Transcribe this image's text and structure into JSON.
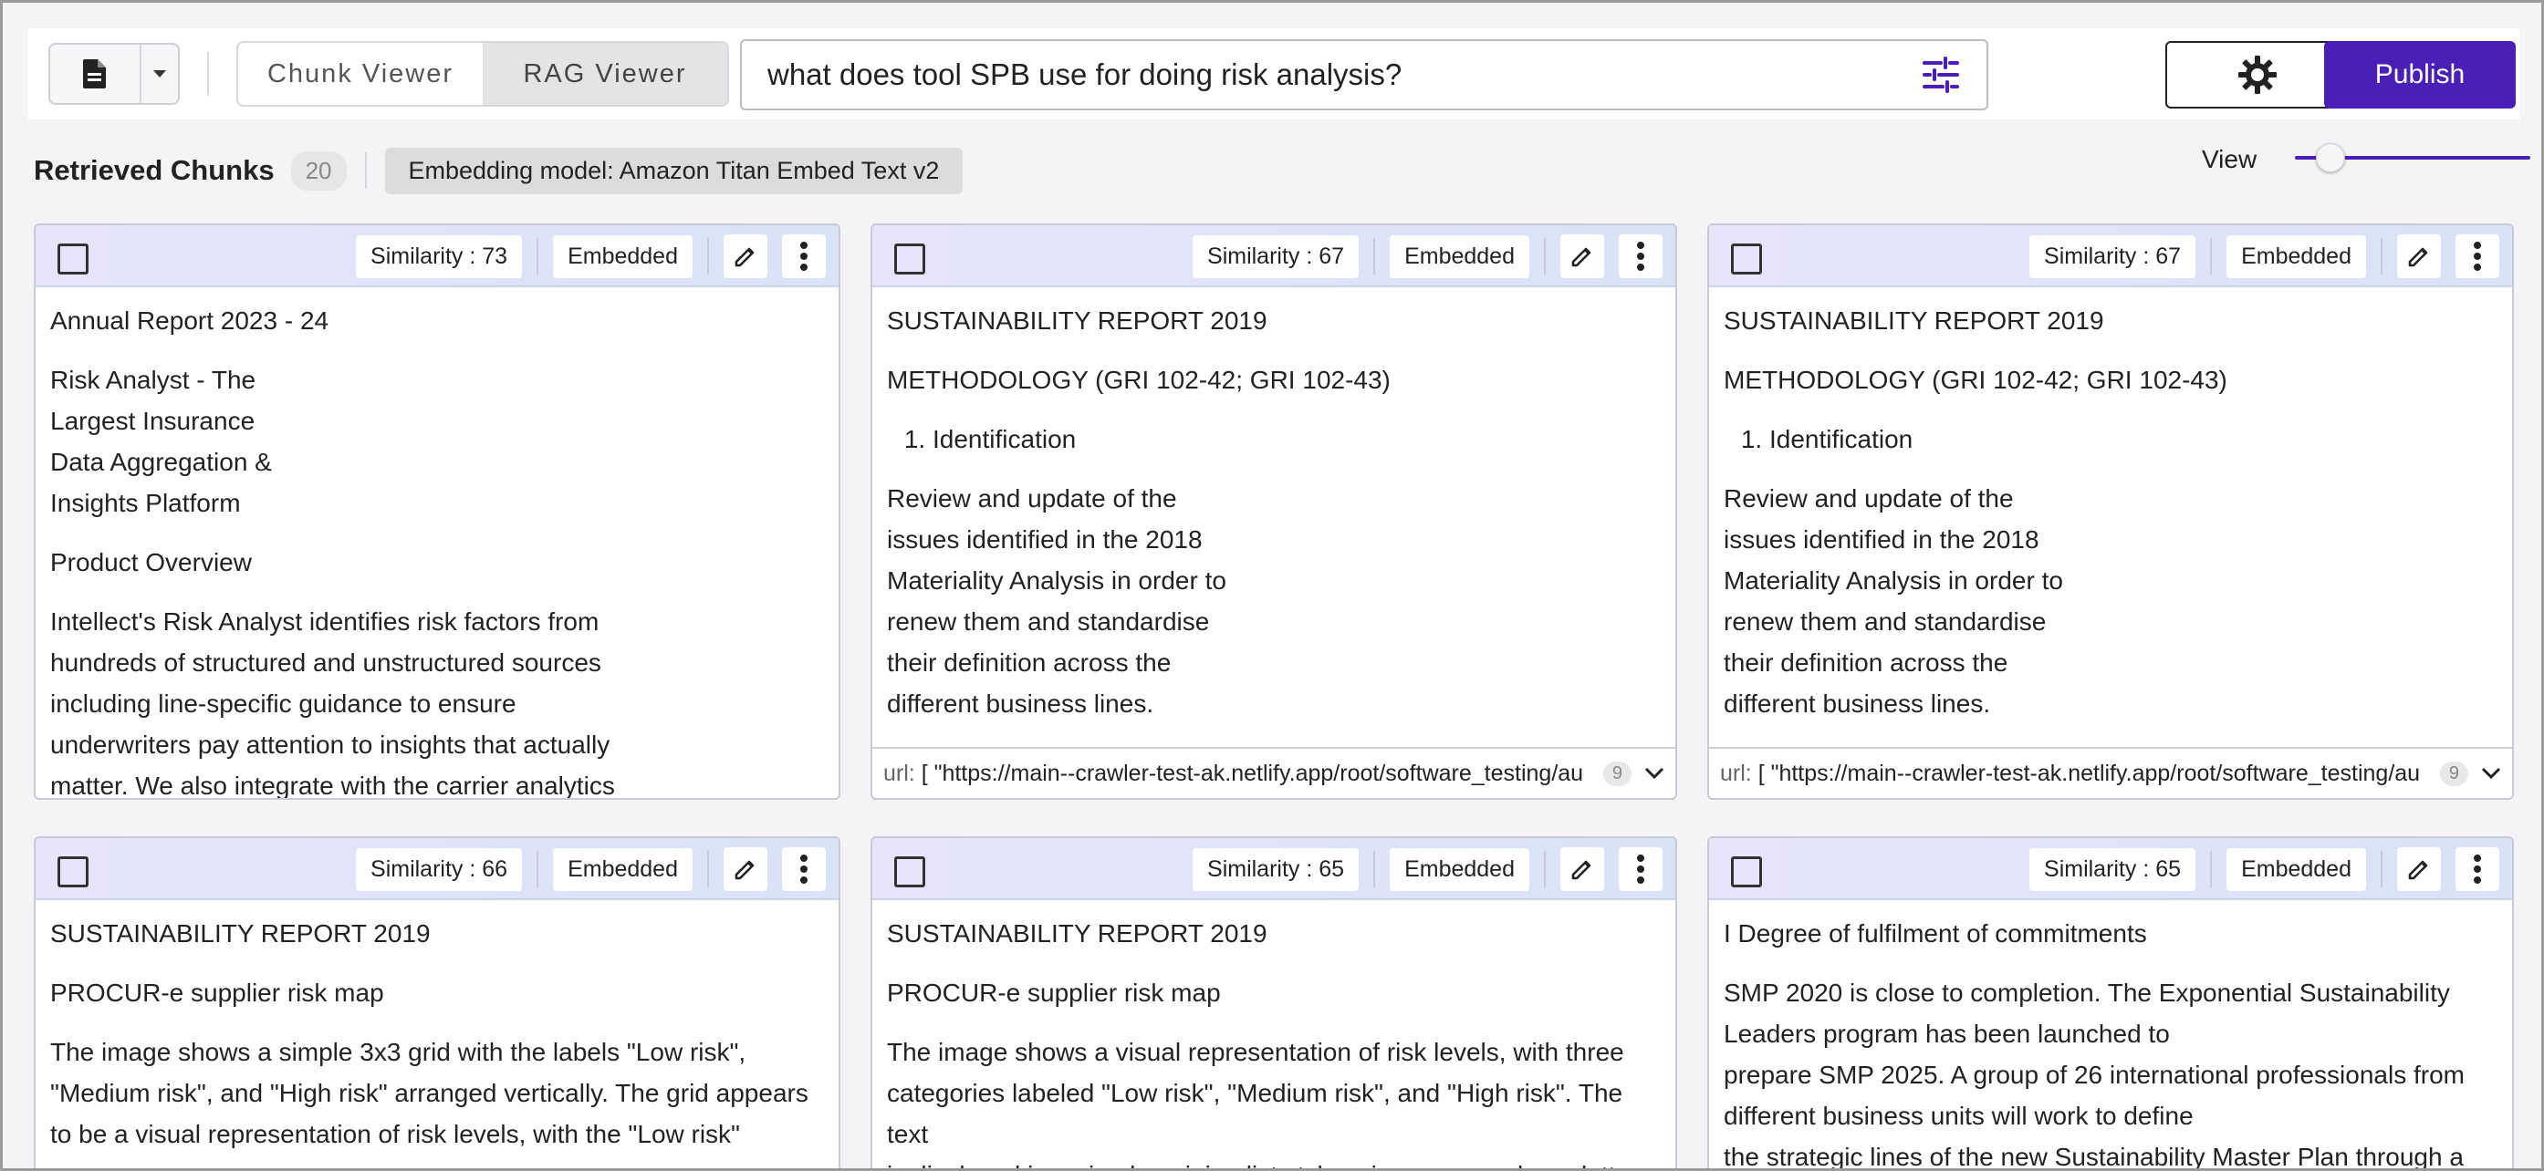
{
  "toolbar": {
    "view_modes": [
      "Chunk Viewer",
      "RAG Viewer"
    ],
    "active_view": "RAG Viewer",
    "search_value": "what does tool SPB use for doing risk analysis?",
    "publish_label": "Publish"
  },
  "subheader": {
    "title": "Retrieved Chunks",
    "count": "20",
    "model_label": "Embedding model: Amazon Titan Embed Text v2",
    "view_label": "View",
    "view_level": 0.1
  },
  "colors": {
    "accent": "#4a1fb8"
  },
  "cards": [
    {
      "similarity": "Similarity : 73",
      "status": "Embedded",
      "paragraphs": [
        "Annual Report 2023 - 24",
        "Risk Analyst - The\nLargest Insurance\nData Aggregation &\nInsights Platform",
        "Product Overview",
        "Intellect's Risk Analyst identifies risk factors from\nhundreds of structured and unstructured sources\nincluding line-specific guidance to ensure\nunderwriters pay attention to insights that actually\nmatter. We also integrate with the carrier analytics"
      ],
      "url_label": "",
      "url_value": "",
      "url_count": ""
    },
    {
      "similarity": "Similarity : 67",
      "status": "Embedded",
      "paragraphs": [
        "SUSTAINABILITY REPORT 2019",
        "METHODOLOGY (GRI 102-42; GRI 102-43)",
        "#1. Identification",
        "Review and update of the\nissues identified in the 2018\nMateriality Analysis in order to\nrenew them and standardise\ntheir definition across the\ndifferent business lines."
      ],
      "url_label": "url:",
      "url_value": "[ \"https://main--crawler-test-ak.netlify.app/root/software_testing/au",
      "url_count": "9"
    },
    {
      "similarity": "Similarity : 67",
      "status": "Embedded",
      "paragraphs": [
        "SUSTAINABILITY REPORT 2019",
        "METHODOLOGY (GRI 102-42; GRI 102-43)",
        "#1. Identification",
        "Review and update of the\nissues identified in the 2018\nMateriality Analysis in order to\nrenew them and standardise\ntheir definition across the\ndifferent business lines."
      ],
      "url_label": "url:",
      "url_value": "[ \"https://main--crawler-test-ak.netlify.app/root/software_testing/au",
      "url_count": "9"
    },
    {
      "similarity": "Similarity : 66",
      "status": "Embedded",
      "paragraphs": [
        "SUSTAINABILITY REPORT 2019",
        "PROCUR-e supplier risk map",
        "The image shows a simple 3x3 grid with the labels \"Low risk\",\n\"Medium risk\", and \"High risk\" arranged vertically. The grid appears\nto be a visual representation of risk levels, with the \"Low risk\""
      ],
      "url_label": "",
      "url_value": "",
      "url_count": ""
    },
    {
      "similarity": "Similarity : 65",
      "status": "Embedded",
      "paragraphs": [
        "SUSTAINABILITY REPORT 2019",
        "PROCUR-e supplier risk map",
        "The image shows a visual representation of risk levels, with three\ncategories labeled \"Low risk\", \"Medium risk\", and \"High risk\". The text\nis displayed in a simple, minimalist style using a gray color palette."
      ],
      "url_label": "",
      "url_value": "",
      "url_count": ""
    },
    {
      "similarity": "Similarity : 65",
      "status": "Embedded",
      "paragraphs": [
        "I Degree of fulfilment of commitments",
        "SMP 2020 is close to completion. The Exponential Sustainability\nLeaders program has been launched to\nprepare SMP 2025. A group of 26 international professionals from\ndifferent business units will work to define\nthe strategic lines of the new Sustainability Master Plan through a"
      ],
      "url_label": "",
      "url_value": "",
      "url_count": ""
    }
  ]
}
